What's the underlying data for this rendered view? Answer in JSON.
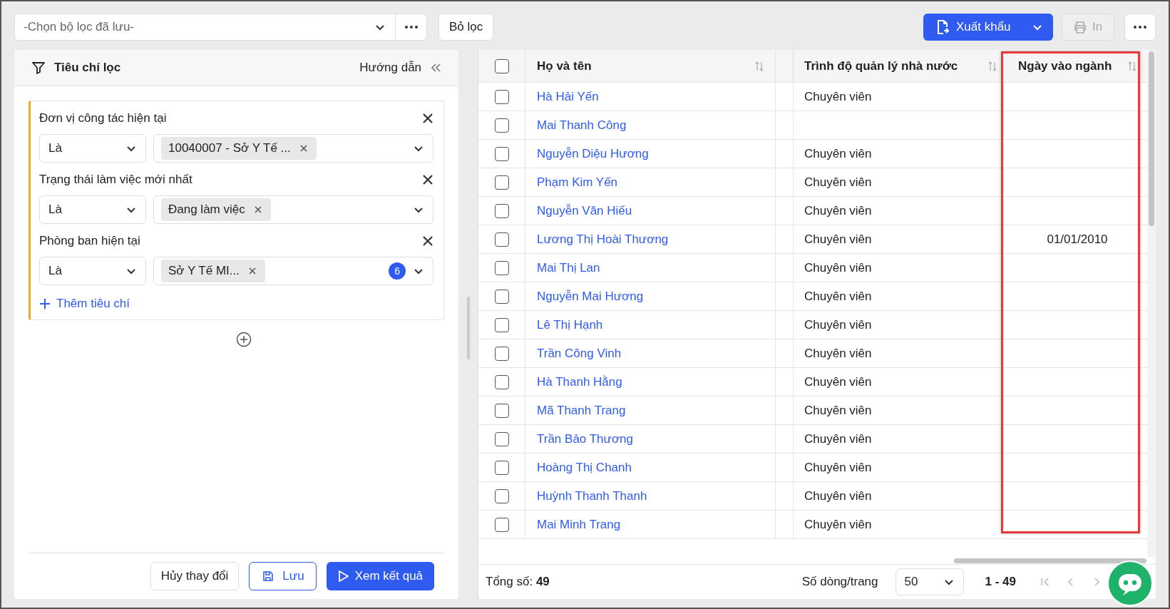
{
  "toolbar": {
    "saved_filter": {
      "placeholder": "-Chọn bộ lọc đã lưu-"
    },
    "clear_button": "Bỏ lọc",
    "export_button": "Xuất khẩu",
    "print_button": {
      "label": "In",
      "disabled": true
    }
  },
  "filter_panel": {
    "title": "Tiêu chí lọc",
    "guide_link": "Hướng dẫn",
    "criteria": [
      {
        "label": "Đơn vị công tác hiện tại",
        "operator": "Là",
        "tags": [
          "10040007 - Sở Y Tế ..."
        ]
      },
      {
        "label": "Trạng thái làm việc mới nhất",
        "operator": "Là",
        "tags": [
          "Đang làm việc"
        ]
      },
      {
        "label": "Phòng ban hiện tại",
        "operator": "Là",
        "tags": [
          "Sở Y Tế MI..."
        ],
        "more_count": "6"
      }
    ],
    "add_criterion": "Thêm tiêu chí",
    "buttons": {
      "cancel": "Hủy thay đổi",
      "save": "Lưu",
      "view": "Xem kết quả"
    }
  },
  "table": {
    "select_all": {
      "checked": false
    },
    "columns": [
      {
        "label": "Họ và tên",
        "highlighted": false
      },
      {
        "label": "Trình độ quản lý nhà nước",
        "highlighted": false
      },
      {
        "label": "Ngày vào ngành",
        "highlighted": true
      }
    ],
    "rows": [
      {
        "name": "Hà Hải Yến",
        "level": "Chuyên viên",
        "date": "",
        "selected": false
      },
      {
        "name": "Mai Thanh Công",
        "level": "",
        "date": "",
        "selected": false
      },
      {
        "name": "Nguyễn Diệu Hương",
        "level": "Chuyên viên",
        "date": "",
        "selected": false
      },
      {
        "name": "Phạm Kim Yến",
        "level": "Chuyên viên",
        "date": "",
        "selected": false
      },
      {
        "name": "Nguyễn Văn Hiếu",
        "level": "Chuyên viên",
        "date": "",
        "selected": false
      },
      {
        "name": "Lương Thị Hoài Thương",
        "level": "Chuyên viên",
        "date": "01/01/2010",
        "selected": false
      },
      {
        "name": "Mai Thị Lan",
        "level": "Chuyên viên",
        "date": "",
        "selected": false
      },
      {
        "name": "Nguyễn Mai Hương",
        "level": "Chuyên viên",
        "date": "",
        "selected": false
      },
      {
        "name": "Lê Thị Hạnh",
        "level": "Chuyên viên",
        "date": "",
        "selected": false
      },
      {
        "name": "Trần Công Vinh",
        "level": "Chuyên viên",
        "date": "",
        "selected": false
      },
      {
        "name": "Hà Thanh Hằng",
        "level": "Chuyên viên",
        "date": "",
        "selected": false
      },
      {
        "name": "Mã Thanh Trang",
        "level": "Chuyên viên",
        "date": "",
        "selected": false
      },
      {
        "name": "Trần Bảo Thương",
        "level": "Chuyên viên",
        "date": "",
        "selected": false
      },
      {
        "name": "Hoàng Thị Chanh",
        "level": "Chuyên viên",
        "date": "",
        "selected": false
      },
      {
        "name": "Huỳnh Thanh Thanh",
        "level": "Chuyên viên",
        "date": "",
        "selected": false
      },
      {
        "name": "Mai Minh Trang",
        "level": "Chuyên viên",
        "date": "",
        "selected": false
      }
    ]
  },
  "pager": {
    "total_label": "Tổng số:",
    "total": "49",
    "page_size_label": "Số dòng/trang",
    "page_size": "50",
    "range": "1 - 49"
  }
}
